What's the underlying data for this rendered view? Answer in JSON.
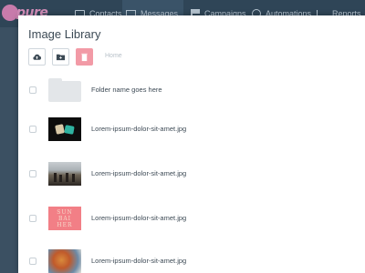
{
  "nav": {
    "logo_text": "pure",
    "items": [
      {
        "label": "Contacts",
        "icon": "contacts-icon"
      },
      {
        "label": "Messages",
        "icon": "mail-icon"
      },
      {
        "label": "Campaigns",
        "icon": "flag-icon"
      },
      {
        "label": "Automations",
        "icon": "gears-icon"
      },
      {
        "label": "Reports",
        "icon": "chart-icon"
      }
    ]
  },
  "modal": {
    "title": "Image Library",
    "toolbar": {
      "upload_icon": "cloud-upload-icon",
      "new_folder_icon": "folder-plus-icon",
      "delete_icon": "trash-icon"
    },
    "breadcrumb": "Home"
  },
  "rows": [
    {
      "type": "folder",
      "label": "Folder name goes here"
    },
    {
      "type": "image",
      "label": "Lorem-ipsum-dolor-sit-amet.jpg",
      "thumbnail": "hands-gesture-album-cover"
    },
    {
      "type": "image",
      "label": "Lorem-ipsum-dolor-sit-amet.jpg",
      "thumbnail": "crowd-landscape-photo"
    },
    {
      "type": "image",
      "label": "Lorem-ipsum-dolor-sit-amet.jpg",
      "thumbnail": "pink-typography-cover",
      "thumb_text": [
        "SUN",
        "BAI",
        "HER"
      ]
    },
    {
      "type": "image",
      "label": "Lorem-ipsum-dolor-sit-amet.jpg",
      "thumbnail": "abstract-painting"
    }
  ],
  "colors": {
    "nav_bg": "#2f4557",
    "delete_button": "#f29aa6",
    "title_text": "#3c4a55"
  }
}
